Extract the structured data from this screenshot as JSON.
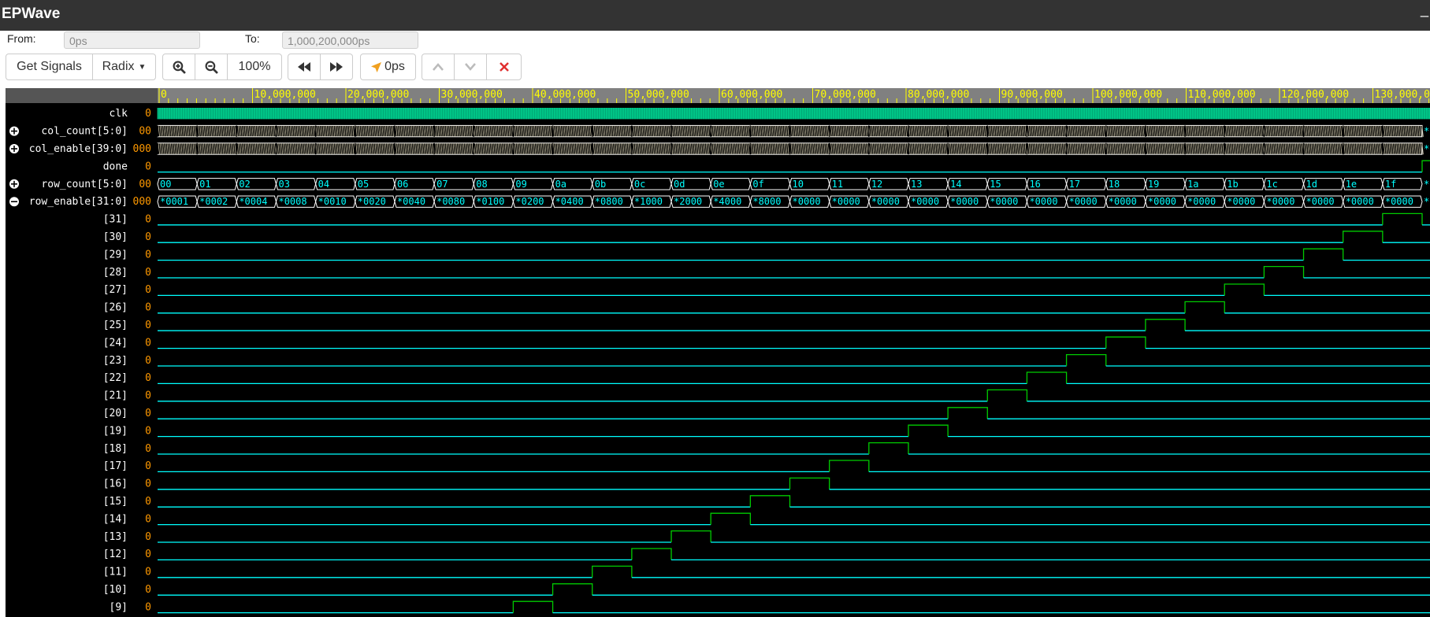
{
  "app": {
    "title": "EPWave",
    "minimize": "_"
  },
  "range": {
    "from_label": "From:",
    "from_value": "0ps",
    "to_label": "To:",
    "to_value": "1,000,200,000ps"
  },
  "toolbar": {
    "get_signals": "Get Signals",
    "radix": "Radix",
    "zoom_level": "100%",
    "cursor_time": "0ps"
  },
  "icons": {
    "zoom_in": "zoom-in-icon",
    "zoom_out": "zoom-out-icon",
    "prev": "rewind-icon",
    "next": "fast-forward-icon",
    "cursor": "cursor-arrow-icon",
    "up": "chevron-up-icon",
    "down": "chevron-down-icon",
    "remove": "close-icon"
  },
  "colors": {
    "background": "#000000",
    "signal_name": "#ffffff",
    "signal_value": "#ff9900",
    "wave_line": "#00ffff",
    "wave_high": "#00cc00",
    "bus_text": "#00ffff",
    "clock": "#00aa77",
    "ruler_text": "#ffff00",
    "ruler_bg": "#808080",
    "remove_icon": "#e03030"
  },
  "ruler": {
    "ticks": [
      "0",
      "10,000,000",
      "20,000,000",
      "30,000,000",
      "40,000,000",
      "50,000,000",
      "60,000,000",
      "70,000,000",
      "80,000,000",
      "90,000,000",
      "100,000,000",
      "110,000,000",
      "120,000,000",
      "130,000,00"
    ]
  },
  "signals": [
    {
      "name": "clk",
      "value": "0",
      "expand": null,
      "type": "clock"
    },
    {
      "name": "col_count[5:0]",
      "value": "00",
      "expand": "plus",
      "type": "dense"
    },
    {
      "name": "col_enable[39:0]",
      "value": "000",
      "expand": "plus",
      "type": "dense"
    },
    {
      "name": "done",
      "value": "0",
      "expand": null,
      "type": "done"
    },
    {
      "name": "row_count[5:0]",
      "value": "00",
      "expand": "plus",
      "type": "bus",
      "segments": [
        "00",
        "01",
        "02",
        "03",
        "04",
        "05",
        "06",
        "07",
        "08",
        "09",
        "0a",
        "0b",
        "0c",
        "0d",
        "0e",
        "0f",
        "10",
        "11",
        "12",
        "13",
        "14",
        "15",
        "16",
        "17",
        "18",
        "19",
        "1a",
        "1b",
        "1c",
        "1d",
        "1e",
        "1f"
      ]
    },
    {
      "name": "row_enable[31:0]",
      "value": "000",
      "expand": "minus",
      "type": "bus",
      "segments": [
        "*0001",
        "*0002",
        "*0004",
        "*0008",
        "*0010",
        "*0020",
        "*0040",
        "*0080",
        "*0100",
        "*0200",
        "*0400",
        "*0800",
        "*1000",
        "*2000",
        "*4000",
        "*8000",
        "*0000",
        "*0000",
        "*0000",
        "*0000",
        "*0000",
        "*0000",
        "*0000",
        "*0000",
        "*0000",
        "*0000",
        "*0000",
        "*0000",
        "*0000",
        "*0000",
        "*0000",
        "*0000"
      ]
    },
    {
      "name": "[31]",
      "value": "0",
      "high_segment": 31
    },
    {
      "name": "[30]",
      "value": "0",
      "high_segment": 30
    },
    {
      "name": "[29]",
      "value": "0",
      "high_segment": 29
    },
    {
      "name": "[28]",
      "value": "0",
      "high_segment": 28
    },
    {
      "name": "[27]",
      "value": "0",
      "high_segment": 27
    },
    {
      "name": "[26]",
      "value": "0",
      "high_segment": 26
    },
    {
      "name": "[25]",
      "value": "0",
      "high_segment": 25
    },
    {
      "name": "[24]",
      "value": "0",
      "high_segment": 24
    },
    {
      "name": "[23]",
      "value": "0",
      "high_segment": 23
    },
    {
      "name": "[22]",
      "value": "0",
      "high_segment": 22
    },
    {
      "name": "[21]",
      "value": "0",
      "high_segment": 21
    },
    {
      "name": "[20]",
      "value": "0",
      "high_segment": 20
    },
    {
      "name": "[19]",
      "value": "0",
      "high_segment": 19
    },
    {
      "name": "[18]",
      "value": "0",
      "high_segment": 18
    },
    {
      "name": "[17]",
      "value": "0",
      "high_segment": 17
    },
    {
      "name": "[16]",
      "value": "0",
      "high_segment": 16
    },
    {
      "name": "[15]",
      "value": "0",
      "high_segment": 15
    },
    {
      "name": "[14]",
      "value": "0",
      "high_segment": 14
    },
    {
      "name": "[13]",
      "value": "0",
      "high_segment": 13
    },
    {
      "name": "[12]",
      "value": "0",
      "high_segment": 12
    },
    {
      "name": "[11]",
      "value": "0",
      "high_segment": 11
    },
    {
      "name": "[10]",
      "value": "0",
      "high_segment": 10
    },
    {
      "name": "[9]",
      "value": "0",
      "high_segment": 9
    }
  ]
}
